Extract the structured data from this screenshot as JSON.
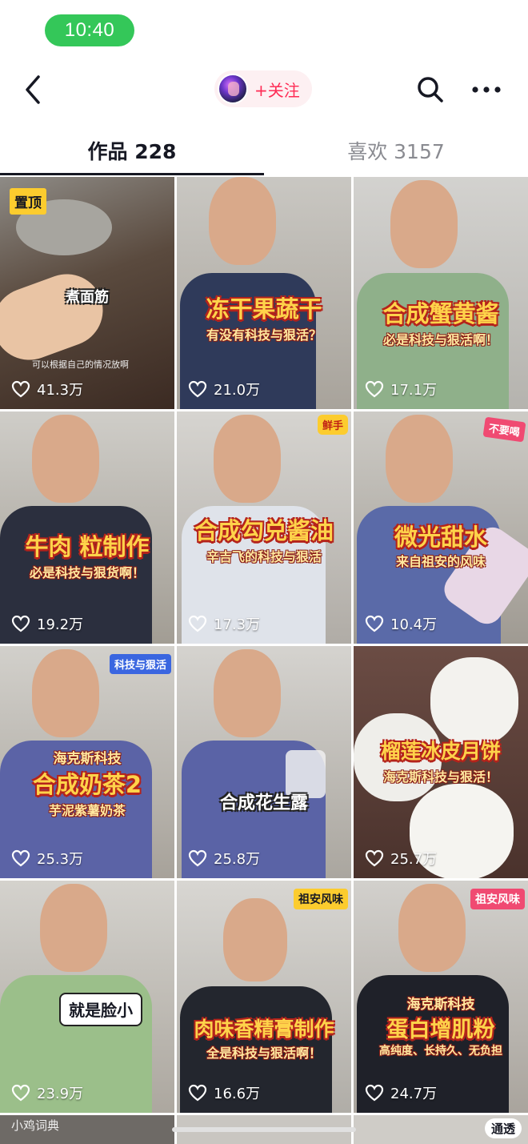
{
  "status": {
    "time": "10:40"
  },
  "nav": {
    "follow_label": "+关注"
  },
  "tabs": [
    {
      "label": "作品 228"
    },
    {
      "label": "喜欢 3157"
    }
  ],
  "videos": [
    {
      "likes": "41.3万",
      "pin": "置顶",
      "caption": "煮面筋",
      "sub": "可以根据自己的情况放啊"
    },
    {
      "likes": "21.0万",
      "caption": "冻干果蔬干",
      "sub": "有没有科技与狠活？"
    },
    {
      "likes": "17.1万",
      "caption": "合成蟹黄酱",
      "sub": "必是科技与狠活啊！"
    },
    {
      "likes": "19.2万",
      "caption": "牛肉 粒制作",
      "sub": "必是科技与狠货啊！"
    },
    {
      "likes": "17.3万",
      "badge": "鲜手",
      "caption": "合成勾兑酱油",
      "sub": "辛吉飞的科技与狠活"
    },
    {
      "likes": "10.4万",
      "badge": "不要喝",
      "caption": "微光甜水",
      "sub": "来自祖安的风味"
    },
    {
      "likes": "25.3万",
      "badge": "科技与狠活",
      "top": "海克斯科技",
      "caption": "合成奶茶2",
      "sub": "芋泥紫薯奶茶"
    },
    {
      "likes": "25.8万",
      "caption": "合成花生露"
    },
    {
      "likes": "25.7万",
      "caption": "榴莲冰皮月饼",
      "sub": "海克斯科技与狠活！"
    },
    {
      "likes": "23.9万",
      "caption": "就是脸小"
    },
    {
      "likes": "16.6万",
      "badge": "祖安风味",
      "caption": "肉味香精膏制作",
      "sub": "全是科技与狠活啊！"
    },
    {
      "likes": "24.7万",
      "badge": "祖安风味",
      "top": "海克斯科技",
      "caption": "蛋白增肌粉",
      "sub": "高纯度、长持久、无负担"
    }
  ],
  "bottom_row": [
    {
      "label": "小鸡词典"
    },
    {
      "label": ""
    },
    {
      "label": "通透"
    }
  ],
  "colors": {
    "accent": "#fe2c55",
    "status_pill": "#34c759",
    "caption_yellow": "#ffd34a"
  },
  "icons": {
    "back": "chevron-left-icon",
    "search": "search-icon",
    "more": "more-dots-icon",
    "like": "heart-outline-icon"
  }
}
